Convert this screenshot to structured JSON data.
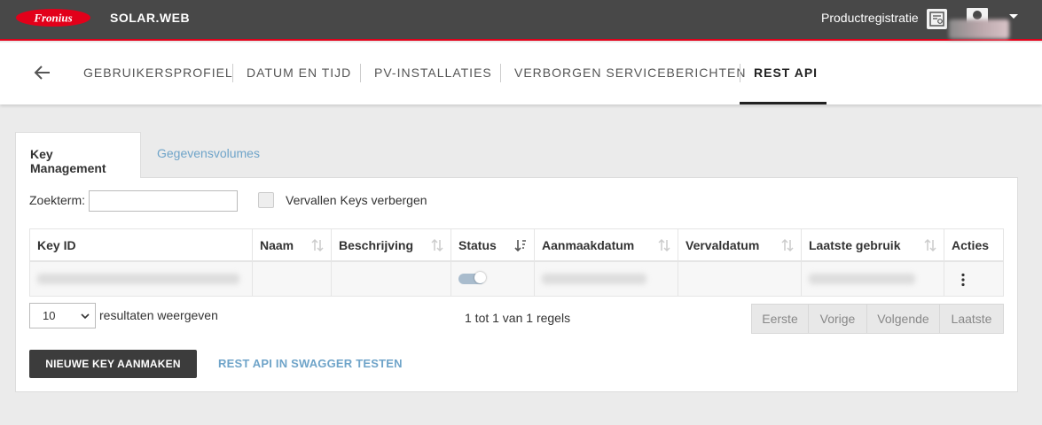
{
  "header": {
    "logo_text": "Fronius",
    "brand": "SOLAR.WEB",
    "product_registration": "Productregistratie",
    "accent_color": "#e2001a"
  },
  "nav": {
    "items": [
      "GEBRUIKERSPROFIEL",
      "DATUM EN TIJD",
      "PV-INSTALLATIES",
      "VERBORGEN SERVICEBERICHTEN",
      "REST API"
    ],
    "active": "REST API"
  },
  "tabs": [
    "Key Management",
    "Gegevensvolumes"
  ],
  "filter": {
    "search_label": "Zoekterm:",
    "search_value": "",
    "hide_expired_label": "Vervallen Keys verbergen"
  },
  "table": {
    "columns": [
      "Key ID",
      "Naam",
      "Beschrijving",
      "Status",
      "Aanmaakdatum",
      "Vervaldatum",
      "Laatste gebruik",
      "Acties"
    ]
  },
  "paging": {
    "page_size": "10",
    "page_size_label": "resultaten weergeven",
    "info": "1 tot 1 van 1 regels",
    "buttons": [
      "Eerste",
      "Vorige",
      "Volgende",
      "Laatste"
    ]
  },
  "actions": {
    "new_key": "NIEUWE KEY AANMAKEN",
    "swagger": "REST API IN SWAGGER TESTEN"
  }
}
